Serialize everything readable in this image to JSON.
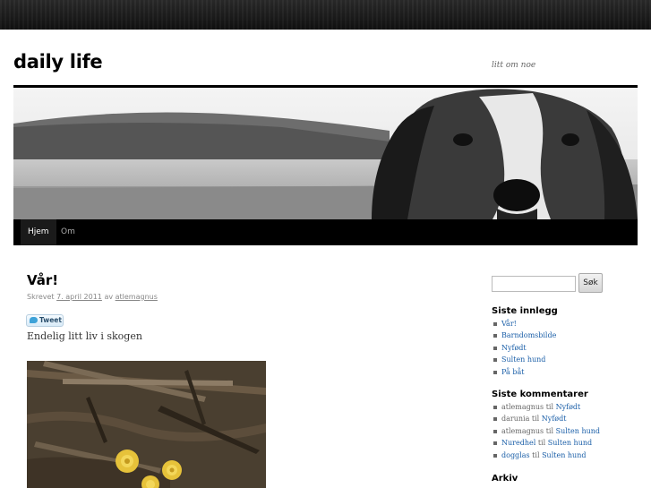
{
  "site": {
    "title": "daily life",
    "description": "litt om noe"
  },
  "nav": {
    "items": [
      {
        "label": "Hjem",
        "active": true
      },
      {
        "label": "Om",
        "active": false
      }
    ]
  },
  "post": {
    "title": "Vår!",
    "meta_prefix": "Skrevet",
    "date": "7. april 2011",
    "meta_by": "av",
    "author": "atlemagnus",
    "tweet_label": "Tweet",
    "text": "Endelig litt liv i skogen"
  },
  "sidebar": {
    "search_button": "Søk",
    "search_value": "",
    "recent_posts_title": "Siste innlegg",
    "recent_posts": [
      "Vår!",
      "Barndomsbilde",
      "Nyfødt",
      "Sulten hund",
      "På båt"
    ],
    "recent_comments_title": "Siste kommentarer",
    "recent_comments": [
      {
        "author": "atlemagnus",
        "author_link": false,
        "sep": "til",
        "post": "Nyfødt"
      },
      {
        "author": "darunia",
        "author_link": false,
        "sep": "til",
        "post": "Nyfødt"
      },
      {
        "author": "atlemagnus",
        "author_link": false,
        "sep": "til",
        "post": "Sulten hund"
      },
      {
        "author": "Nuredhel",
        "author_link": true,
        "sep": "til",
        "post": "Sulten hund"
      },
      {
        "author": "dogglas",
        "author_link": true,
        "sep": "til",
        "post": "Sulten hund"
      }
    ],
    "archive_title": "Arkiv"
  },
  "colors": {
    "link": "#1b5fa8",
    "nav_bg": "#000000",
    "text": "#333333"
  }
}
